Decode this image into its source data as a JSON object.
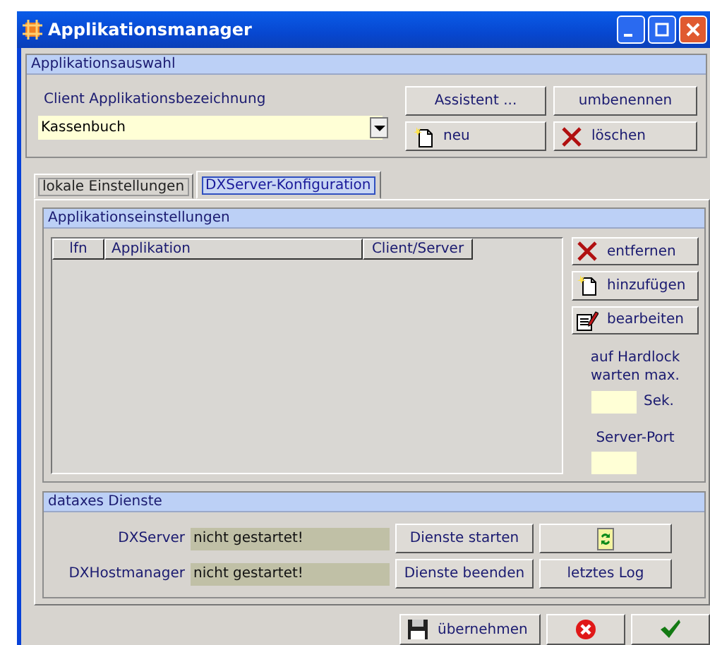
{
  "window": {
    "title": "Applikationsmanager"
  },
  "app_selection": {
    "title": "Applikationsauswahl",
    "label": "Client Applikationsbezeichnung",
    "value": "Kassenbuch",
    "buttons": [
      "Assistent ...",
      "umbenennen",
      "neu",
      "löschen"
    ]
  },
  "tabs": [
    {
      "label": "lokale Einstellungen",
      "selected": false
    },
    {
      "label": "DXServer-Konfiguration",
      "selected": true
    }
  ],
  "app_settings": {
    "title": "Applikationseinstellungen",
    "table": {
      "columns": [
        "lfn",
        "Applikation",
        "Client/Server"
      ]
    },
    "buttons": [
      "entfernen",
      "hinzufügen",
      "bearbeiten"
    ],
    "hardlock_label": "auf Hardlock warten max.",
    "unit": "Sek.",
    "port_label": "Server-Port"
  },
  "services": {
    "title": "dataxes Dienste",
    "rows": [
      {
        "label": "DXServer",
        "status": "nicht gestartet!",
        "button": "Dienste starten"
      },
      {
        "label": "DXHostmanager",
        "status": "nicht gestartet!",
        "button": "Dienste beenden"
      }
    ],
    "log_button": "letztes Log"
  },
  "footer": {
    "apply_button": "übernehmen"
  }
}
